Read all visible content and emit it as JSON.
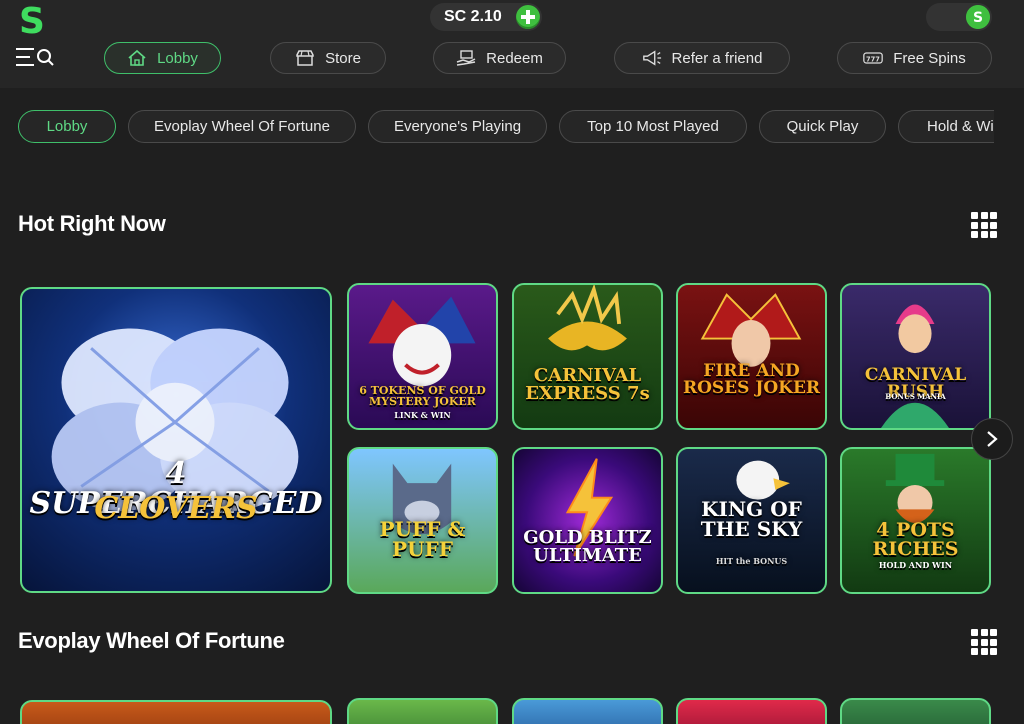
{
  "header": {
    "balance": "SC 2.10",
    "nav": [
      {
        "label": "Lobby",
        "icon": "home-icon",
        "active": true
      },
      {
        "label": "Store",
        "icon": "store-icon"
      },
      {
        "label": "Redeem",
        "icon": "redeem-icon"
      },
      {
        "label": "Refer a friend",
        "icon": "megaphone-icon"
      },
      {
        "label": "Free Spins",
        "icon": "slot-777-icon"
      }
    ]
  },
  "tabs": [
    "Lobby",
    "Evoplay Wheel Of Fortune",
    "Everyone's Playing",
    "Top 10 Most Played",
    "Quick Play",
    "Hold & Wi"
  ],
  "sections": {
    "hot": {
      "title": "Hot Right Now",
      "featured": {
        "title_line1": "4 SUPERCHARGED",
        "title_line2": "CLOVERS"
      },
      "games": [
        {
          "title": "6 TOKENS OF GOLD MYSTERY JOKER",
          "sub": "LINK & WIN"
        },
        {
          "title": "CARNIVAL EXPRESS 7s"
        },
        {
          "title": "FIRE AND ROSES JOKER"
        },
        {
          "title": "CARNIVAL RUSH",
          "sub": "BONUS MANIA"
        },
        {
          "title": "PUFF & PUFF"
        },
        {
          "title": "GOLD BLITZ ULTIMATE"
        },
        {
          "title": "KING OF THE SKY",
          "sub": "HIT the BONUS"
        },
        {
          "title": "4 POTS RICHES",
          "sub": "HOLD AND WIN"
        }
      ]
    },
    "evoplay": {
      "title": "Evoplay Wheel Of Fortune"
    }
  },
  "colors": {
    "accent": "#5fd985",
    "background": "#1f1f1f",
    "header": "#262626"
  }
}
